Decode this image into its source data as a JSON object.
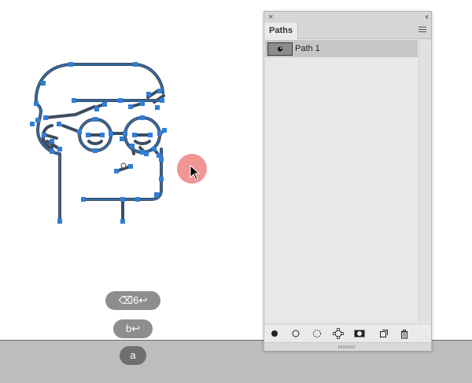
{
  "panel": {
    "close_glyph": "×",
    "collapse_glyph": "‹‹",
    "tab_label": "Paths",
    "menu_icon": "panel-menu-icon",
    "paths": [
      {
        "label": "Path 1",
        "selected": true
      }
    ],
    "footer_buttons": [
      "fill-path-icon",
      "stroke-path-icon",
      "load-as-selection-icon",
      "make-work-path-icon",
      "add-mask-icon",
      "new-path-icon",
      "delete-path-icon"
    ]
  },
  "keystrokes": {
    "key1": "⌫6↩",
    "key2": "b↩",
    "key3": "a"
  },
  "colors": {
    "selection_blue": "#2f7fd8",
    "path_stroke": "#3d4d5e",
    "cursor_highlight": "#f08a8a",
    "pasteboard": "#bdbdbd",
    "panel_bg": "#eaeaea"
  }
}
